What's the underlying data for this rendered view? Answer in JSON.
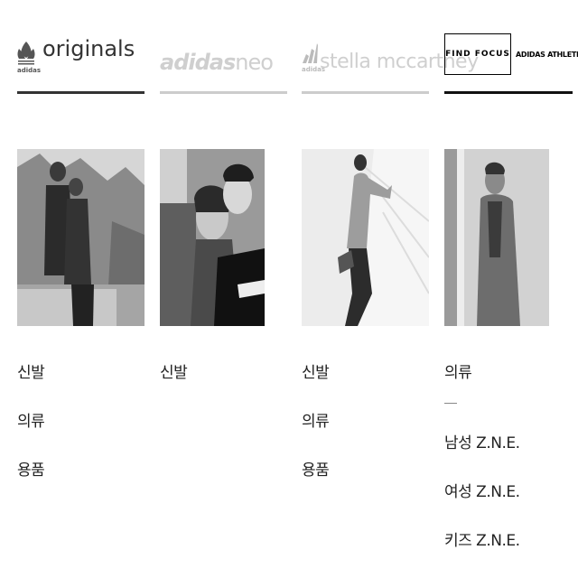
{
  "colors": {
    "active_underline": "#333333",
    "inactive_underline": "#cccccc",
    "inactive_brand": "#cfcfcf"
  },
  "brands": [
    {
      "id": "originals",
      "logo_icon": "trefoil-icon",
      "logo_small_text": "adidas",
      "name": "originals",
      "links": [
        "신발",
        "의류",
        "용품"
      ]
    },
    {
      "id": "neo",
      "logo_text_bold": "adidas",
      "logo_text_light": "neo",
      "links": [
        "신발"
      ]
    },
    {
      "id": "stella",
      "logo_icon": "performance-icon",
      "logo_small_text": "adidas",
      "name": "stella mccartney",
      "links": [
        "신발",
        "의류",
        "용품"
      ]
    },
    {
      "id": "athletics",
      "find_focus": "FIND FOCUS",
      "athletics_label": "ADIDAS ATHLETICS",
      "links": [
        "의류",
        "남성 Z.N.E.",
        "여성 Z.N.E.",
        "키즈 Z.N.E."
      ]
    }
  ]
}
